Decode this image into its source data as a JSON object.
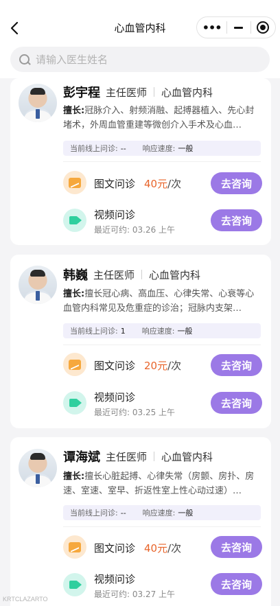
{
  "nav": {
    "title": "心血管内科",
    "more": "•••"
  },
  "search": {
    "placeholder": "请输入医生姓名"
  },
  "labels": {
    "specialty_prefix": "擅长:",
    "online_label": "当前线上问诊:",
    "response_label": "响应速度:",
    "text_service": "图文问诊",
    "video_service": "视频问诊",
    "recent_prefix": "最近可约:",
    "consult_button": "去咨询"
  },
  "doctors": [
    {
      "name": "彭宇程",
      "title": "主任医师",
      "dept": "心血管内科",
      "specialty": "冠脉介入、射频消融、起搏器植入、先心封堵术，外周血管重建等微创介入手术及心血…",
      "online": "--",
      "response": "一般",
      "text_price": "40元",
      "text_unit": "/次",
      "video_recent": "03.26  上午"
    },
    {
      "name": "韩巍",
      "title": "主任医师",
      "dept": "心血管内科",
      "specialty": "擅长冠心病、高血压、心律失常、心衰等心血管内科常见及危重症的诊治；冠脉内支架…",
      "online": "1",
      "response": "一般",
      "text_price": "20元",
      "text_unit": "/次",
      "video_recent": "03.25  上午"
    },
    {
      "name": "谭海斌",
      "title": "主任医师",
      "dept": "心血管内科",
      "specialty": "擅长心脏起搏、心律失常（房颤、房扑、房速、室速、室早、折返性室上性心动过速）…",
      "online": "--",
      "response": "一般",
      "text_price": "40元",
      "text_unit": "/次",
      "video_recent": "03.27  上午"
    }
  ],
  "watermark": "KRTCLAZARTO",
  "colors": {
    "accent": "#9b79e6",
    "price": "#e8642a"
  }
}
